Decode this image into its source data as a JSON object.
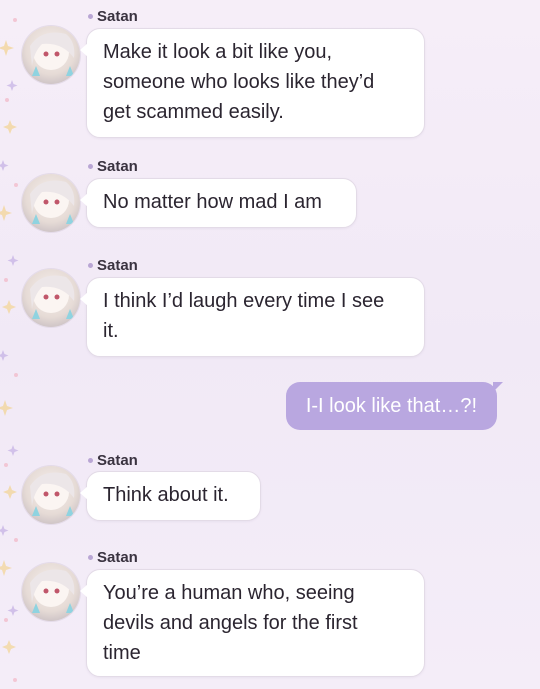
{
  "messages": [
    {
      "sender": "Satan",
      "text": "Make it look a bit like you,\nsomeone who looks like they’d\nget scammed easily."
    },
    {
      "sender": "Satan",
      "text": "No matter how mad I am"
    },
    {
      "sender": "Satan",
      "text": "I think I’d laugh every time I see\nit."
    },
    {
      "sender": "Satan",
      "text": "Think about it."
    },
    {
      "sender": "Satan",
      "text": "You’re a human who, seeing\ndevils and angels for the first\ntime"
    }
  ],
  "outgoing": {
    "text": "I-I look like that…?!"
  },
  "colors": {
    "outgoing_bubble": "#b9a7e0",
    "incoming_bubble": "#ffffff",
    "background": "#f3ebf7"
  }
}
